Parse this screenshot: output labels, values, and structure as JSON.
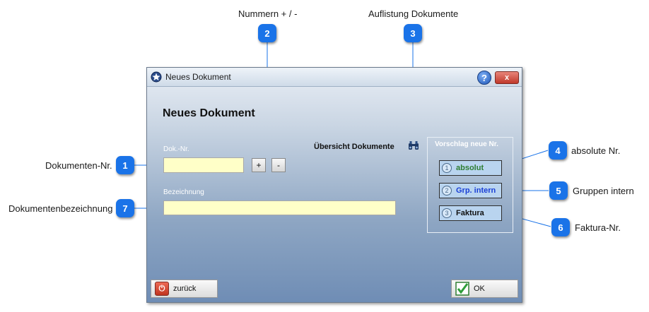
{
  "annotations": {
    "top": [
      {
        "label": "Nummern + / -",
        "badge": "2"
      },
      {
        "label": "Auflistung Dokumente",
        "badge": "3"
      }
    ],
    "left": [
      {
        "label": "Dokumenten-Nr.",
        "badge": "1"
      },
      {
        "label": "Dokumentenbezeichnung",
        "badge": "7"
      }
    ],
    "right": [
      {
        "label": "absolute Nr.",
        "badge": "4"
      },
      {
        "label": "Gruppen intern",
        "badge": "5"
      },
      {
        "label": "Faktura-Nr.",
        "badge": "6"
      }
    ]
  },
  "window": {
    "title": "Neues Dokument",
    "help": "?",
    "close": "x"
  },
  "form": {
    "heading": "Neues Dokument",
    "doc_nr_label": "Dok.-Nr.",
    "doc_nr_value": "",
    "plus": "+",
    "minus": "-",
    "overview_label": "Übersicht Dokumente",
    "bezeichnung_label": "Bezeichnung",
    "bezeichnung_value": ""
  },
  "suggestion": {
    "title": "Vorschlag neue Nr.",
    "buttons": [
      {
        "num": "1",
        "label": "absolut",
        "color": "#2e7d32"
      },
      {
        "num": "2",
        "label": "Grp. intern",
        "color": "#1a3fd6"
      },
      {
        "num": "3",
        "label": "Faktura",
        "color": "#111111"
      }
    ]
  },
  "footer": {
    "back_label": "zurück",
    "ok_label": "OK"
  },
  "colors": {
    "badge": "#1a73e8",
    "input_bg": "#ffffc8",
    "suggest_bg": "#b9d4ef"
  }
}
